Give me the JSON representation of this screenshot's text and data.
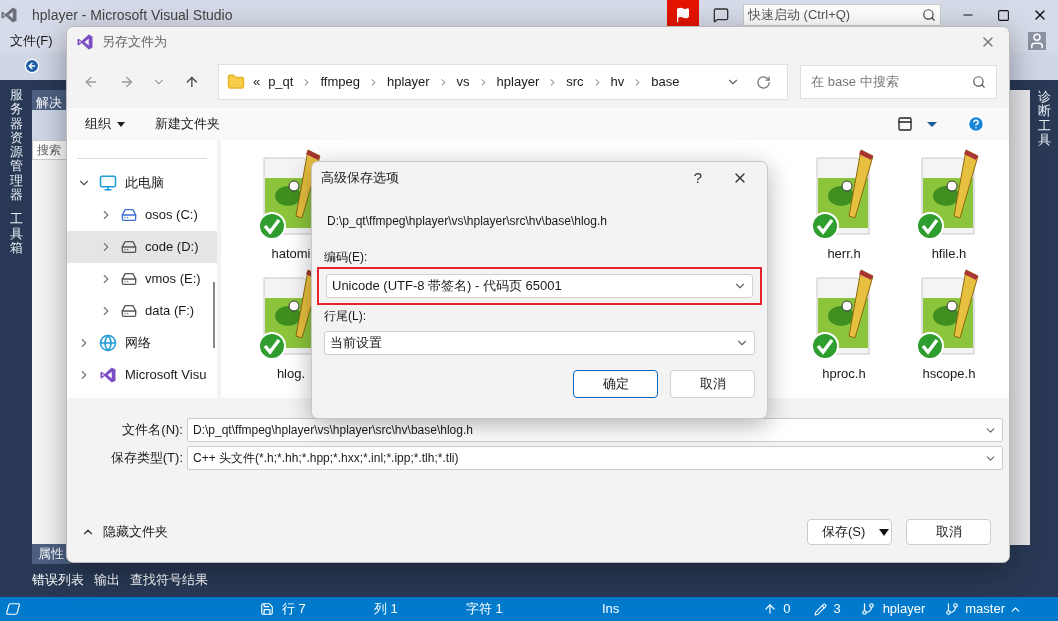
{
  "vs_window": {
    "title": "hplayer - Microsoft Visual Studio",
    "menu": [
      "文件(F)"
    ],
    "quick_launch": {
      "placeholder": "快速启动 (Ctrl+Q)"
    }
  },
  "left_tool_tabs": [
    "服务器资源管理器",
    "工具箱"
  ],
  "right_tool_tabs": [
    "诊断工具"
  ],
  "solution_explorer": {
    "title": "解决",
    "search": {
      "placeholder": "搜索"
    }
  },
  "lower_tabs": [
    {
      "label": "属性",
      "selected": true
    }
  ],
  "bottom_tabs": [
    "错误列表",
    "输出",
    "查找符号结果"
  ],
  "status_bar": {
    "line": "行 7",
    "column": "列 1",
    "char": "字符 1",
    "mode": "Ins",
    "pushes": "0",
    "changes": "3",
    "repo": "hplayer",
    "branch": "master"
  },
  "save_dialog": {
    "title": "另存文件为",
    "breadcrumb": [
      "«",
      "p_qt",
      "ffmpeg",
      "hplayer",
      "vs",
      "hplayer",
      "src",
      "hv",
      "base"
    ],
    "search": {
      "placeholder": "在 base 中搜索"
    },
    "commands": [
      {
        "label": "组织",
        "menu": true
      },
      {
        "label": "新建文件夹",
        "menu": false
      }
    ],
    "nav_tree": [
      {
        "label": "此电脑",
        "kind": "computer",
        "expanded": true,
        "selected": false,
        "children": [
          {
            "label": "osos (C:)",
            "kind": "system-drive",
            "expanded": false,
            "selected": false
          },
          {
            "label": "code (D:)",
            "kind": "drive",
            "expanded": false,
            "selected": true
          },
          {
            "label": "vmos (E:)",
            "kind": "drive",
            "expanded": false,
            "selected": false
          },
          {
            "label": "data (F:)",
            "kind": "drive",
            "expanded": false,
            "selected": false
          }
        ]
      },
      {
        "label": "网络",
        "kind": "network",
        "expanded": false,
        "selected": false
      },
      {
        "label": "Microsoft Visu",
        "kind": "app",
        "expanded": false,
        "selected": false
      }
    ],
    "files_left": [
      "hatomi",
      "hlog."
    ],
    "files_right": [
      "herr.h",
      "hfile.h",
      "hproc.h",
      "hscope.h"
    ],
    "file_name": {
      "label": "文件名(N):",
      "value": "D:\\p_qt\\ffmpeg\\hplayer\\vs\\hplayer\\src\\hv\\base\\hlog.h"
    },
    "file_type": {
      "label": "保存类型(T):",
      "value": "C++ 头文件(*.h;*.hh;*.hpp;*.hxx;*.inl;*.ipp;*.tlh;*.tli)"
    },
    "hide_folders": "隐藏文件夹",
    "save_button": "保存(S)",
    "cancel_button": "取消"
  },
  "advanced_dialog": {
    "title": "高级保存选项",
    "help": "?",
    "path": "D:\\p_qt\\ffmpeg\\hplayer\\vs\\hplayer\\src\\hv\\base\\hlog.h",
    "encoding": {
      "label": "编码(E):",
      "value": "Unicode (UTF-8 带签名) - 代码页 65001",
      "highlighted": true
    },
    "line_endings": {
      "label": "行尾(L):",
      "value": "当前设置"
    },
    "ok_button": "确定",
    "cancel_button": "取消"
  }
}
